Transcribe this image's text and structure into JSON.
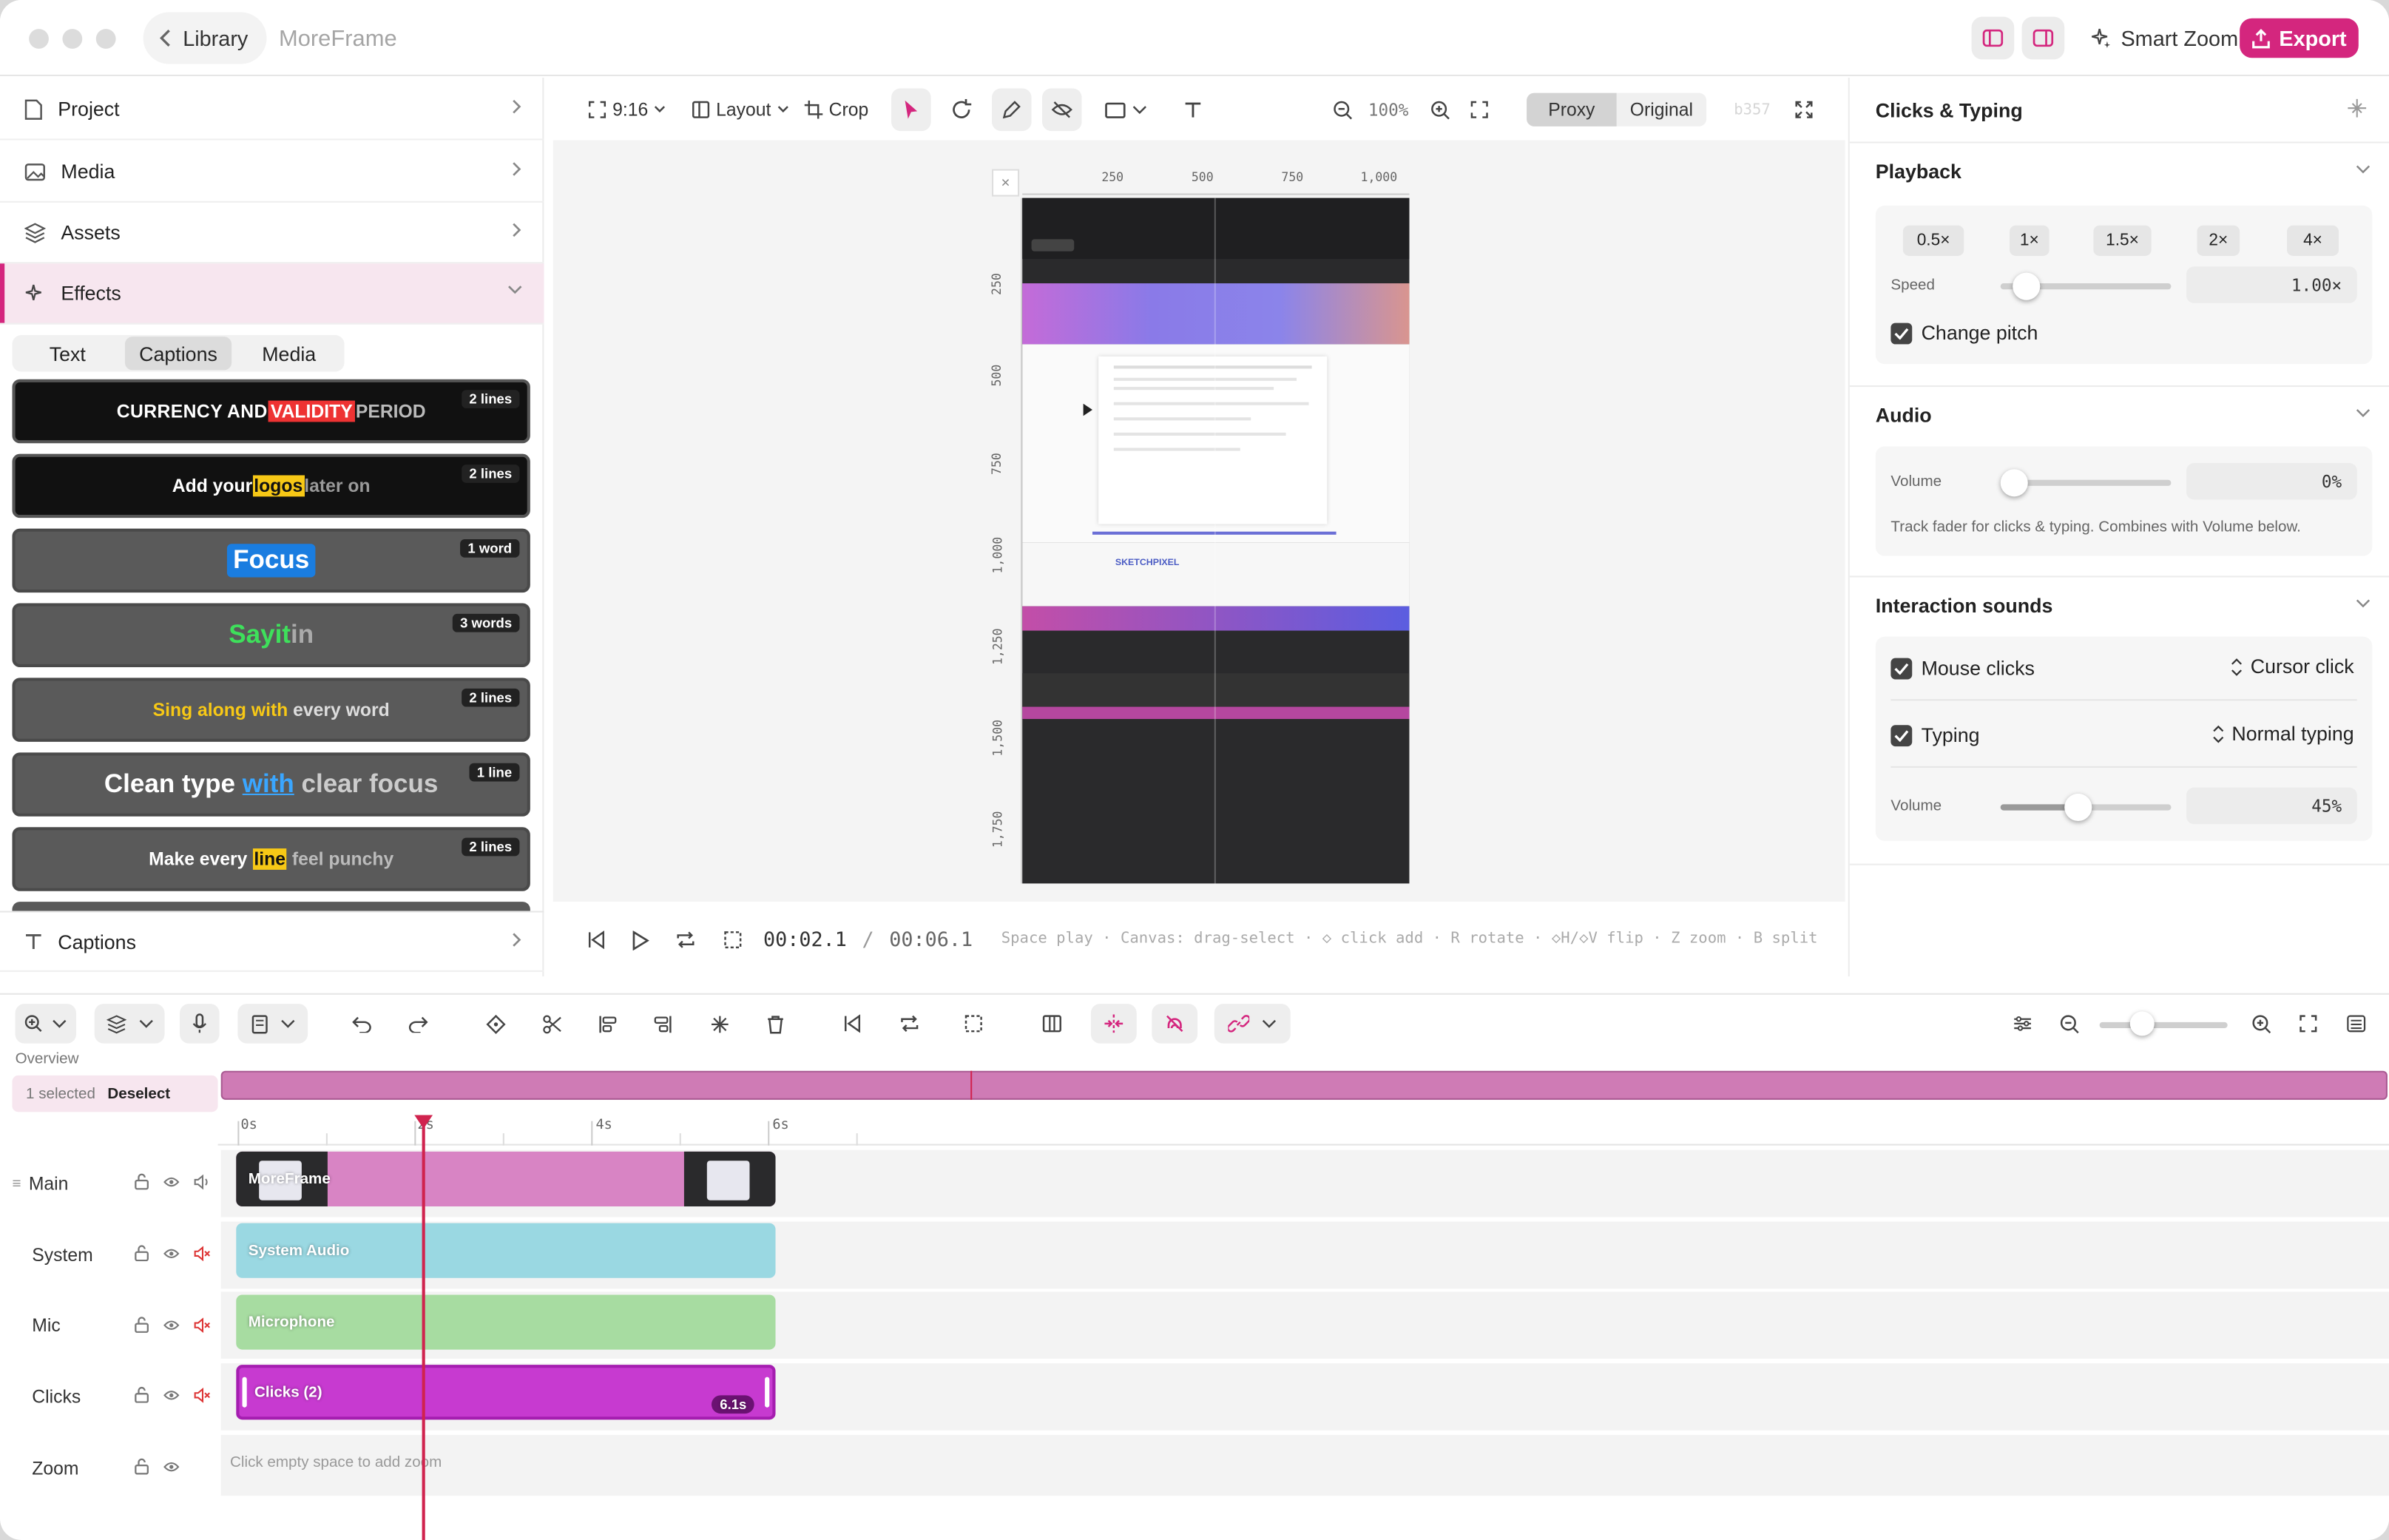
{
  "titlebar": {
    "back_label": "Library",
    "app_name": "MoreFrame",
    "smart_zoom_label": "Smart Zoom",
    "export_label": "Export",
    "accent_color": "#d4267e"
  },
  "sidebar": {
    "items": [
      {
        "label": "Project",
        "icon": "file-icon"
      },
      {
        "label": "Media",
        "icon": "image-icon"
      },
      {
        "label": "Assets",
        "icon": "layers-icon"
      },
      {
        "label": "Effects",
        "icon": "sparkles-icon"
      },
      {
        "label": "Captions",
        "icon": "text-icon"
      }
    ],
    "tabs": [
      "Text",
      "Captions",
      "Media"
    ],
    "active_tab": "Captions",
    "caption_styles": [
      {
        "parts": [
          "CURRENCY AND ",
          "VALIDITY",
          " PERIOD"
        ],
        "badge": "2 lines"
      },
      {
        "parts": [
          "Add your ",
          "logos",
          " later on"
        ],
        "badge": "2 lines"
      },
      {
        "parts": [
          "Focus"
        ],
        "badge": "1 word"
      },
      {
        "parts": [
          "Say ",
          "it",
          " in"
        ],
        "badge": "3 words"
      },
      {
        "parts": [
          "Sing along with ",
          "every word"
        ],
        "badge": "2 lines"
      },
      {
        "parts": [
          "Clean type ",
          "with",
          " clear focus"
        ],
        "badge": "1 line"
      },
      {
        "parts": [
          "Make every ",
          "line",
          " feel punchy"
        ],
        "badge": "2 lines"
      }
    ]
  },
  "canvas_toolbar": {
    "aspect": "9:16",
    "layout_label": "Layout",
    "crop_label": "Crop",
    "zoom": "100%",
    "proxy_label": "Proxy",
    "original_label": "Original",
    "faded_code": "b357"
  },
  "canvas": {
    "ruler_top": [
      "250",
      "500",
      "750",
      "1,000"
    ],
    "ruler_left": [
      "250",
      "500",
      "750",
      "1,000",
      "1,250",
      "1,500",
      "1,750"
    ],
    "preview_brand": "SKETCHPIXEL"
  },
  "playback": {
    "current_time": "00:02.1",
    "separator": "/",
    "total_time": "00:06.1",
    "hint": "Space play · Canvas: drag-select · ◇ click add · R rotate · ◇H/◇V flip · Z zoom · B split"
  },
  "right_panel": {
    "title": "Clicks & Typing",
    "playback": {
      "heading": "Playback",
      "speeds": [
        "0.5×",
        "1×",
        "1.5×",
        "2×",
        "4×"
      ],
      "speed_label": "Speed",
      "speed_value": "1.00×",
      "speed_fraction": 0.08,
      "change_pitch_label": "Change pitch",
      "change_pitch": true
    },
    "audio": {
      "heading": "Audio",
      "volume_label": "Volume",
      "volume_value": "0%",
      "volume_fraction": 0.0,
      "note": "Track fader for clicks & typing. Combines with Volume below."
    },
    "interaction_sounds": {
      "heading": "Interaction sounds",
      "mouse_clicks_label": "Mouse clicks",
      "mouse_clicks_sound": "Cursor click",
      "typing_label": "Typing",
      "typing_sound": "Normal typing",
      "volume_label": "Volume",
      "volume_value": "45%",
      "volume_fraction": 0.45
    }
  },
  "timeline": {
    "overview_label": "Overview",
    "selected_label": "1 selected",
    "deselect_label": "Deselect",
    "ticks": [
      "0s",
      "2s",
      "4s",
      "6s"
    ],
    "playhead_time": "00:02.1",
    "tracks": [
      {
        "name": "Main",
        "clip": "MoreFrame",
        "color": "#d884c4"
      },
      {
        "name": "System",
        "clip": "System Audio",
        "color": "#9ad8e2"
      },
      {
        "name": "Mic",
        "clip": "Microphone",
        "color": "#a7dca1"
      },
      {
        "name": "Clicks",
        "clip": "Clicks (2)",
        "clip_badge": "6.1s",
        "color": "#c73ad0"
      },
      {
        "name": "Zoom",
        "hint": "Click empty space to add zoom"
      }
    ]
  }
}
